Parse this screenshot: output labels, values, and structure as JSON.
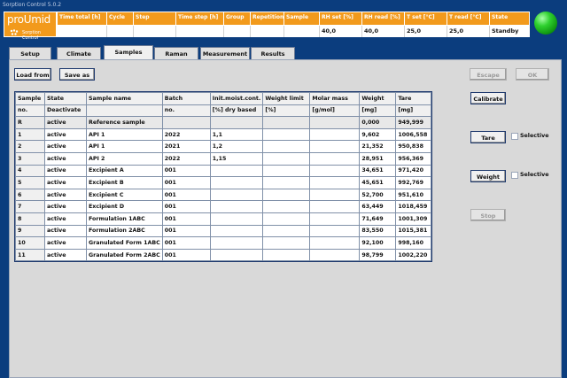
{
  "window": {
    "title": "Sorption Control 5.0.2"
  },
  "logo": {
    "brand": "proUmid",
    "sub": "Sorption Control"
  },
  "status": {
    "headers": [
      "Time total [h]",
      "Cycle",
      "Step",
      "Time step [h]",
      "Group",
      "Repetition",
      "Sample",
      "RH set [%]",
      "RH read [%]",
      "T set [°C]",
      "T read [°C]",
      "State"
    ],
    "values": [
      "",
      "",
      "",
      "",
      "",
      "",
      "",
      "40,0",
      "40,0",
      "25,0",
      "25,0",
      "Standby"
    ]
  },
  "tabs": [
    "Setup",
    "Climate",
    "Samples",
    "Raman",
    "Measurement",
    "Results"
  ],
  "active_tab": "Samples",
  "toolbar": {
    "load": "Load from",
    "save": "Save as",
    "escape": "Escape",
    "ok": "OK"
  },
  "side": {
    "calibrate": "Calibrate",
    "tare": "Tare",
    "weight": "Weight",
    "stop": "Stop",
    "selective": "Selective"
  },
  "table": {
    "header1": [
      "Sample",
      "State",
      "Sample name",
      "Batch",
      "Init.moist.cont.",
      "Weight limit",
      "Molar mass",
      "Weight",
      "Tare"
    ],
    "header2": [
      "no.",
      "Deactivate",
      "",
      "no.",
      "[%] dry based",
      "[%]",
      "[g/mol]",
      "[mg]",
      "[mg]"
    ],
    "rows": [
      [
        "R",
        "active",
        "Reference sample",
        "",
        "",
        "",
        "",
        "0,000",
        "949,999"
      ],
      [
        "1",
        "active",
        "API 1",
        "2022",
        "1,1",
        "",
        "",
        "9,602",
        "1006,558"
      ],
      [
        "2",
        "active",
        "API 1",
        "2021",
        "1,2",
        "",
        "",
        "21,352",
        "950,838"
      ],
      [
        "3",
        "active",
        "API 2",
        "2022",
        "1,15",
        "",
        "",
        "28,951",
        "956,369"
      ],
      [
        "4",
        "active",
        "Excipient A",
        "001",
        "",
        "",
        "",
        "34,651",
        "971,420"
      ],
      [
        "5",
        "active",
        "Excipient B",
        "001",
        "",
        "",
        "",
        "45,651",
        "992,769"
      ],
      [
        "6",
        "active",
        "Excipient C",
        "001",
        "",
        "",
        "",
        "52,700",
        "951,610"
      ],
      [
        "7",
        "active",
        "Excipient D",
        "001",
        "",
        "",
        "",
        "63,449",
        "1018,459"
      ],
      [
        "8",
        "active",
        "Formulation 1ABC",
        "001",
        "",
        "",
        "",
        "71,649",
        "1001,309"
      ],
      [
        "9",
        "active",
        "Formulation 2ABC",
        "001",
        "",
        "",
        "",
        "83,550",
        "1015,381"
      ],
      [
        "10",
        "active",
        "Granulated Form 1ABC",
        "001",
        "",
        "",
        "",
        "92,100",
        "998,160"
      ],
      [
        "11",
        "active",
        "Granulated Form 2ABC",
        "001",
        "",
        "",
        "",
        "98,799",
        "1002,220"
      ]
    ]
  },
  "colors": {
    "brand_orange": "#f29a1c",
    "frame_blue": "#0b3d7e",
    "led_green": "#2fd12f"
  }
}
